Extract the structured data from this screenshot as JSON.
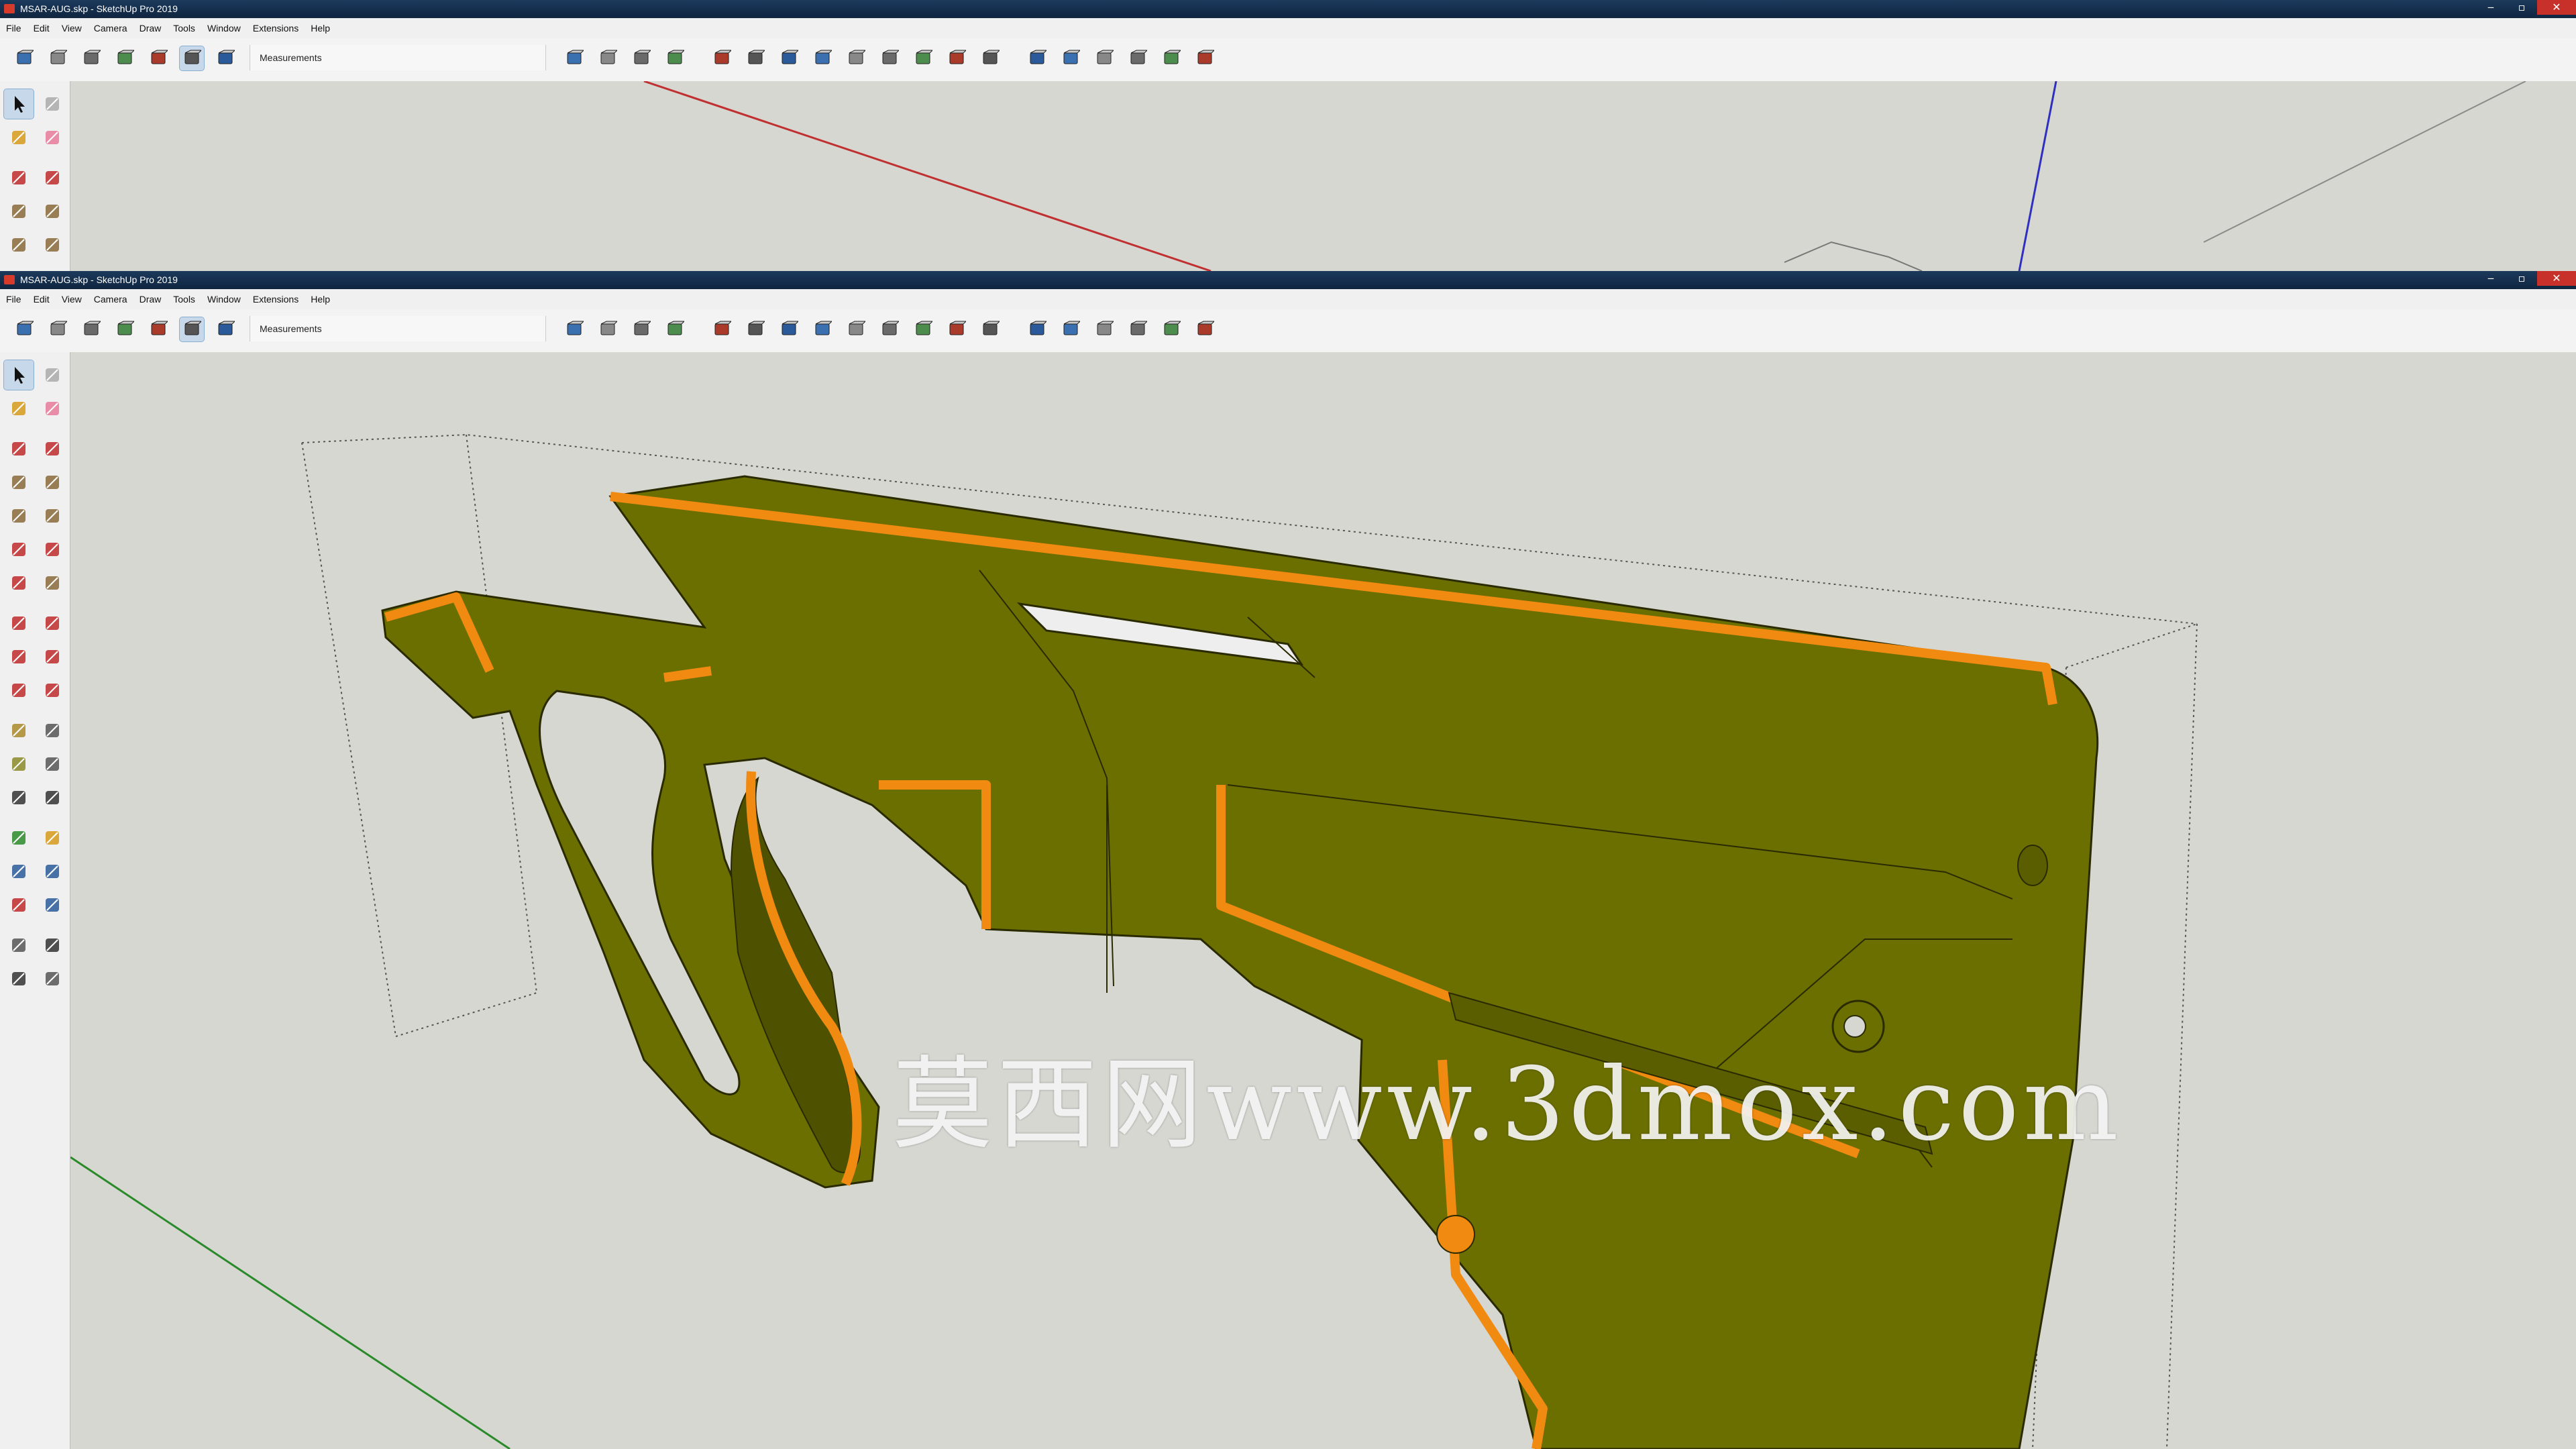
{
  "window_title": "MSAR-AUG.skp - SketchUp Pro 2019",
  "window_controls": {
    "minimize": "‒",
    "maximize": "▫",
    "close": "✕"
  },
  "menu": [
    "File",
    "Edit",
    "View",
    "Camera",
    "Draw",
    "Tools",
    "Window",
    "Extensions",
    "Help"
  ],
  "measurements_label": "Measurements",
  "watermark": "莫西网www.3dmox.com",
  "colors": {
    "model_body": "#6b6f00",
    "section_cut": "#f08a10",
    "axis_red": "#c03030",
    "axis_green": "#2a8a2a",
    "axis_blue": "#3030c0",
    "titlebar": "#0f2540",
    "selected_tool": "#c7d8ea"
  },
  "top_toolbar_icons": [
    "shaded-box-icon",
    "xray-icon",
    "wireframe-icon",
    "hidden-line-icon",
    "shaded-icon",
    "shaded-textures-icon",
    "monochrome-icon",
    "sandbox-contours-icon",
    "sandbox-scratch-icon",
    "sandbox-smoove-icon",
    "stamp-icon",
    "drape-icon",
    "add-detail-icon",
    "flip-edge-icon",
    "solid-outer-shell-icon",
    "solid-intersect-icon",
    "solid-union-icon",
    "solid-subtract-icon",
    "solid-trim-icon",
    "solid-split-icon",
    "iso-view-icon",
    "top-view-icon",
    "front-view-icon",
    "right-view-icon",
    "back-view-icon",
    "left-view-icon"
  ],
  "left_toolbar_icons": [
    "select-arrow-icon",
    "make-component-icon",
    "paint-bucket-icon",
    "eraser-icon",
    "line-pencil-icon",
    "freehand-icon",
    "rectangle-icon",
    "rotated-rectangle-icon",
    "circle-icon",
    "polygon-icon",
    "arc-icon",
    "two-point-arc-icon",
    "three-point-arc-icon",
    "pie-icon",
    "move-icon",
    "push-pull-icon",
    "rotate-icon",
    "follow-me-icon",
    "scale-icon",
    "offset-icon",
    "tape-measure-icon",
    "dimension-icon",
    "protractor-icon",
    "text-icon",
    "axes-icon",
    "3d-text-icon",
    "orbit-icon",
    "pan-icon",
    "zoom-icon",
    "zoom-window-icon",
    "zoom-extents-icon",
    "previous-view-icon",
    "position-camera-icon",
    "look-around-icon",
    "walk-icon",
    "section-plane-icon"
  ]
}
